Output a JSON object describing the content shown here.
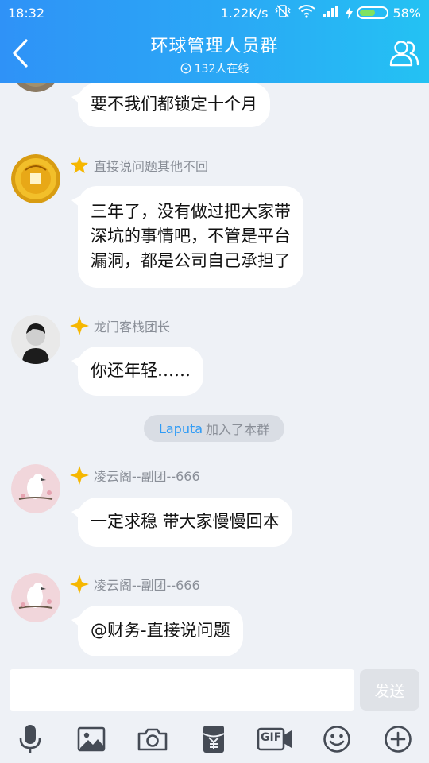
{
  "status_bar": {
    "time": "18:32",
    "speed": "1.22K/s",
    "battery": "58%",
    "battery_level": 0.58
  },
  "header": {
    "title": "环球管理人员群",
    "online": "132人在线"
  },
  "messages": [
    {
      "text": "要不我们都锁定十个月"
    },
    {
      "sender": "直接说问题其他不回",
      "text_lines": [
        "三年了，没有做过把大家带",
        "深坑的事情吧，不管是平台",
        "漏洞，都是公司自己承担了"
      ]
    },
    {
      "sender": "龙门客栈团长",
      "text": "你还年轻……"
    },
    {
      "sender": "凌云阁--副团--666",
      "text": "一定求稳 带大家慢慢回本"
    },
    {
      "sender": "凌云阁--副团--666",
      "text": "@财务-直接说问题"
    }
  ],
  "system_notice": {
    "name": "Laputa",
    "text": "加入了本群"
  },
  "input": {
    "send_label": "发送"
  },
  "toolbar": {
    "gif_label": "GIF"
  },
  "colors": {
    "header_start": "#2f92f7",
    "header_end": "#24c2f3",
    "link": "#2f9bf5",
    "badge": "#f6b700"
  }
}
